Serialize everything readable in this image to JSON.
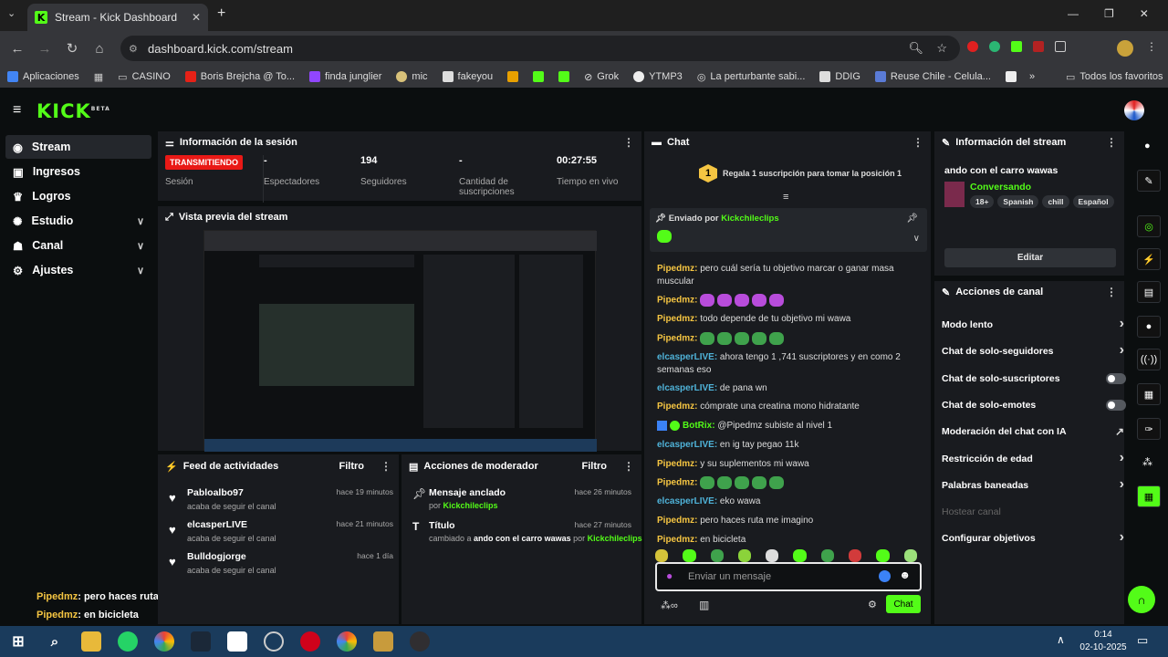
{
  "browser": {
    "tab_title": "Stream - Kick Dashboard",
    "url": "dashboard.kick.com/stream",
    "bookmarks": [
      "Aplicaciones",
      "CASINO",
      "Boris Brejcha @ To...",
      "finda junglier",
      "mic",
      "fakeyou",
      "Grok",
      "YTMP3",
      "La perturbante sabi...",
      "DDIG",
      "Reuse Chile - Celula..."
    ],
    "all_bookmarks": "Todos los favoritos"
  },
  "logo": "KICK",
  "logo_beta": "BETA",
  "sidebar": {
    "items": [
      {
        "label": "Stream"
      },
      {
        "label": "Ingresos"
      },
      {
        "label": "Logros"
      },
      {
        "label": "Estudio"
      },
      {
        "label": "Canal"
      },
      {
        "label": "Ajustes"
      }
    ]
  },
  "session": {
    "title": "Información de la sesión",
    "status": "TRANSMITIENDO",
    "status_label": "Sesión",
    "stats": [
      {
        "value": "-",
        "label": "Espectadores"
      },
      {
        "value": "194",
        "label": "Seguidores"
      },
      {
        "value": "-",
        "label": "Cantidad de suscripciones"
      },
      {
        "value": "00:27:55",
        "label": "Tiempo en vivo"
      }
    ]
  },
  "preview": {
    "title": "Vista previa del stream"
  },
  "feed": {
    "title": "Feed de actividades",
    "filter": "Filtro",
    "items": [
      {
        "name": "Pabloalbo97",
        "sub": "acaba de seguir el canal",
        "time": "hace 19 minutos"
      },
      {
        "name": "elcasperLIVE",
        "sub": "acaba de seguir el canal",
        "time": "hace 21 minutos"
      },
      {
        "name": "Bulldogjorge",
        "sub": "acaba de seguir el canal",
        "time": "hace 1 día"
      }
    ]
  },
  "mod": {
    "title": "Acciones de moderador",
    "filter": "Filtro",
    "items": [
      {
        "title": "Mensaje anclado",
        "by_prefix": "por",
        "user": "Kickchileclips",
        "time": "hace 26 minutos"
      },
      {
        "title": "Título",
        "changed": "cambiado a",
        "value": "ando con el carro wawas",
        "by_prefix": "por",
        "user": "Kickchileclips",
        "time": "hace 27 minutos"
      }
    ]
  },
  "overlay": [
    {
      "user": "Pipedmz",
      "text": ": pero haces ruta me imagino"
    },
    {
      "user": "Pipedmz",
      "text": ": en bicicleta"
    }
  ],
  "chat": {
    "title": "Chat",
    "gift_rank": "1",
    "gift_text": "Regala 1 suscripción para tomar la posición 1",
    "pinned_by_prefix": "Enviado por",
    "pinned_user": "Kickchileclips",
    "messages": [
      {
        "user": "Pipedmz",
        "text": "pero cuál sería tu objetivo marcar o ganar masa muscular",
        "color": "#f5c542"
      },
      {
        "user": "Pipedmz",
        "text": "",
        "color": "#f5c542",
        "emotes": 5,
        "emote_color": "#b84cdb"
      },
      {
        "user": "Pipedmz",
        "text": "todo depende de tu objetivo mi wawa",
        "color": "#f5c542"
      },
      {
        "user": "Pipedmz",
        "text": "",
        "color": "#f5c542",
        "emotes": 5,
        "emote_color": "#3fa24c"
      },
      {
        "user": "elcasperLIVE",
        "text": "ahora tengo 1 ,741 suscriptores y en como 2 semanas eso",
        "color": "#4fb3d9"
      },
      {
        "user": "elcasperLIVE",
        "text": "de pana wn",
        "color": "#4fb3d9"
      },
      {
        "user": "Pipedmz",
        "text": "cómprate una creatina mono hidratante",
        "color": "#f5c542"
      },
      {
        "user": "BotRix",
        "text": "@Pipedmz subiste al nivel 1",
        "color": "#53fc18"
      },
      {
        "user": "elcasperLIVE",
        "text": "en ig tay pegao 11k",
        "color": "#4fb3d9"
      },
      {
        "user": "Pipedmz",
        "text": "y su suplementos mi wawa",
        "color": "#f5c542"
      },
      {
        "user": "Pipedmz",
        "text": "",
        "color": "#f5c542",
        "emotes": 5,
        "emote_color": "#3fa24c"
      },
      {
        "user": "elcasperLIVE",
        "text": "eko wawa",
        "color": "#4fb3d9"
      },
      {
        "user": "Pipedmz",
        "text": "pero haces ruta me imagino",
        "color": "#f5c542"
      },
      {
        "user": "Pipedmz",
        "text": "en bicicleta",
        "color": "#f5c542"
      }
    ],
    "input_placeholder": "Enviar un mensaje",
    "send": "Chat"
  },
  "stream_info": {
    "title": "Información del stream",
    "stream_title": "ando con el carro wawas",
    "category": "Conversando",
    "tags": [
      "18+",
      "Spanish",
      "chill",
      "Español"
    ],
    "edit": "Editar"
  },
  "channel_actions": {
    "title": "Acciones de canal",
    "items": [
      {
        "label": "Modo lento",
        "ctrl": "chevron"
      },
      {
        "label": "Chat de solo-seguidores",
        "ctrl": "chevron"
      },
      {
        "label": "Chat de solo-suscriptores",
        "ctrl": "toggle"
      },
      {
        "label": "Chat de solo-emotes",
        "ctrl": "toggle"
      },
      {
        "label": "Moderación del chat con IA",
        "ctrl": "external"
      },
      {
        "label": "Restricción de edad",
        "ctrl": "chevron"
      },
      {
        "label": "Palabras baneadas",
        "ctrl": "chevron"
      },
      {
        "label": "Hostear canal",
        "ctrl": "none"
      },
      {
        "label": "Configurar objetivos",
        "ctrl": "chevron"
      }
    ]
  },
  "clock": {
    "time": "0:14",
    "date": "02-10-2025"
  },
  "colors": {
    "accent": "#53fc18",
    "live": "#e91916",
    "panel": "#191b1f"
  }
}
